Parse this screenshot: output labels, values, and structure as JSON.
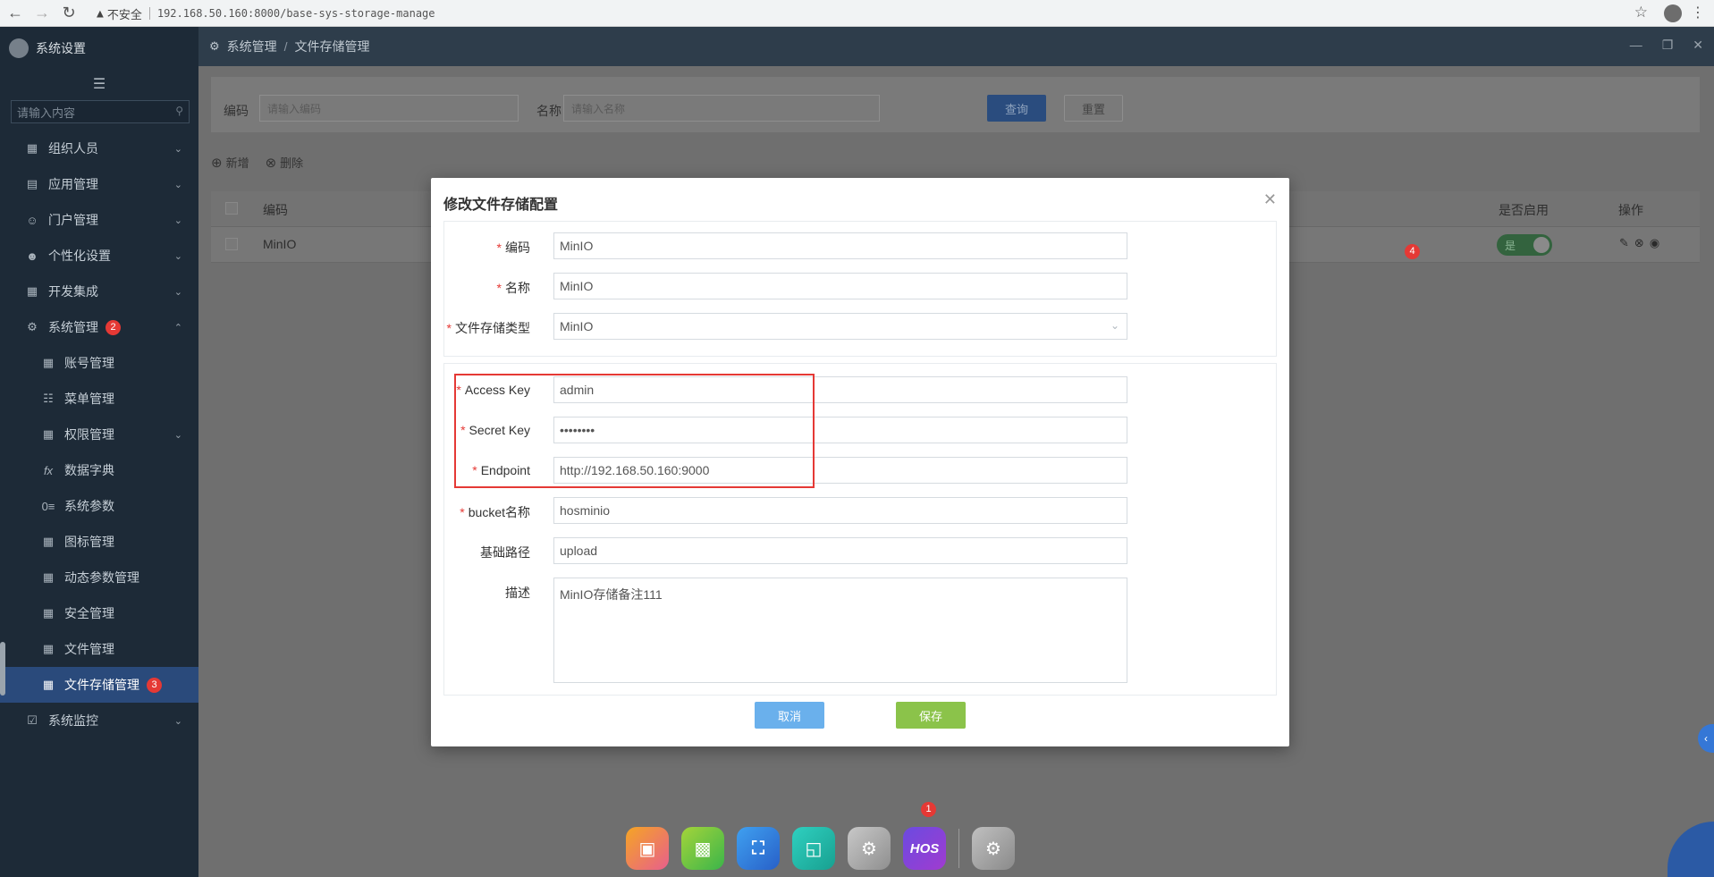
{
  "browser": {
    "insecure_label": "不安全",
    "url": "192.168.50.160:8000/base-sys-storage-manage"
  },
  "sidebar": {
    "title": "系统设置",
    "search_placeholder": "请输入内容",
    "items": [
      {
        "label": "组织人员",
        "icon": "grid-icon"
      },
      {
        "label": "应用管理",
        "icon": "app-icon"
      },
      {
        "label": "门户管理",
        "icon": "user-icon"
      },
      {
        "label": "个性化设置",
        "icon": "person-icon"
      },
      {
        "label": "开发集成",
        "icon": "grid-icon"
      },
      {
        "label": "系统管理",
        "icon": "gear-icon",
        "badge": "2"
      },
      {
        "label": "账号管理",
        "icon": "grid-icon"
      },
      {
        "label": "菜单管理",
        "icon": "table-icon"
      },
      {
        "label": "权限管理",
        "icon": "grid-icon"
      },
      {
        "label": "数据字典",
        "icon": "fx-icon"
      },
      {
        "label": "系统参数",
        "icon": "param-icon"
      },
      {
        "label": "图标管理",
        "icon": "grid-icon"
      },
      {
        "label": "动态参数管理",
        "icon": "grid-icon"
      },
      {
        "label": "安全管理",
        "icon": "grid-icon"
      },
      {
        "label": "文件管理",
        "icon": "grid-icon"
      },
      {
        "label": "文件存储管理",
        "icon": "grid-icon",
        "badge": "3"
      },
      {
        "label": "系统监控",
        "icon": "monitor-icon"
      }
    ]
  },
  "topbar": {
    "crumb_root": "系统管理",
    "crumb_sep": "/",
    "crumb_current": "文件存储管理"
  },
  "filter": {
    "code_label": "编码",
    "code_placeholder": "请输入编码",
    "name_label": "名称",
    "name_placeholder": "请输入名称",
    "query_label": "查询",
    "reset_label": "重置"
  },
  "toolbar": {
    "add_label": "新增",
    "delete_label": "删除"
  },
  "table": {
    "headers": {
      "code": "编码",
      "enabled": "是否启用",
      "ops": "操作"
    },
    "rows": [
      {
        "code": "MinIO",
        "enabled_text": "是"
      }
    ],
    "ops_badge": "4"
  },
  "modal": {
    "title": "修改文件存储配置",
    "fields": {
      "code_label": "编码",
      "code_value": "MinIO",
      "name_label": "名称",
      "name_value": "MinIO",
      "type_label": "文件存储类型",
      "type_value": "MinIO",
      "access_label": "Access Key",
      "access_value": "admin",
      "secret_label": "Secret Key",
      "secret_value": "••••••••",
      "endpoint_label": "Endpoint",
      "endpoint_value": "http://192.168.50.160:9000",
      "bucket_label": "bucket名称",
      "bucket_value": "hosminio",
      "path_label": "基础路径",
      "path_value": "upload",
      "desc_label": "描述",
      "desc_value": "MinIO存储备注111"
    },
    "cancel_label": "取消",
    "save_label": "保存"
  },
  "dock": {
    "hos_label": "HOS",
    "badge": "1"
  },
  "colors": {
    "sidebar_bg": "#1d2a37",
    "active_bg": "#2a4a7b",
    "save_green": "#8bc34a",
    "cancel_blue": "#6ab0ec",
    "badge_red": "#e53935"
  }
}
